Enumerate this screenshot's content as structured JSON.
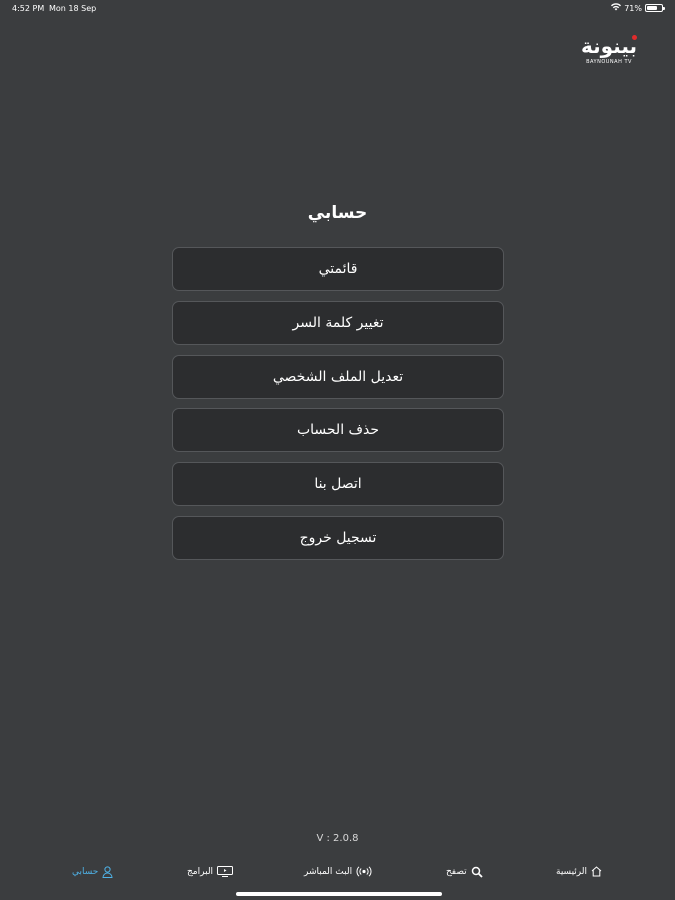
{
  "status": {
    "time": "4:52 PM",
    "date": "Mon 18 Sep",
    "battery": "71%",
    "battery_level": 0.71
  },
  "logo": {
    "main": "بينونة",
    "sub": "BAYNOUNAH TV",
    "dot_color": "#e02b2b"
  },
  "page": {
    "title": "حسابي"
  },
  "menu": {
    "items": [
      {
        "label": "قائمتي"
      },
      {
        "label": "تغيير كلمة السر"
      },
      {
        "label": "تعديل الملف الشخصي"
      },
      {
        "label": "حذف الحساب"
      },
      {
        "label": "اتصل بنا"
      },
      {
        "label": "تسجيل خروج"
      }
    ]
  },
  "version": "V : 2.0.8",
  "tabs": [
    {
      "label": "الرئيسية",
      "icon": "home-icon"
    },
    {
      "label": "تصفح",
      "icon": "search-icon"
    },
    {
      "label": "البث المباشر",
      "icon": "broadcast-icon"
    },
    {
      "label": "البرامج",
      "icon": "tv-icon"
    },
    {
      "label": "حسابي",
      "icon": "user-icon",
      "active": true
    }
  ],
  "colors": {
    "background": "#3b3d3f",
    "button": "#2c2d2f",
    "button_border": "#55575a",
    "accent": "#4fb3e8"
  }
}
